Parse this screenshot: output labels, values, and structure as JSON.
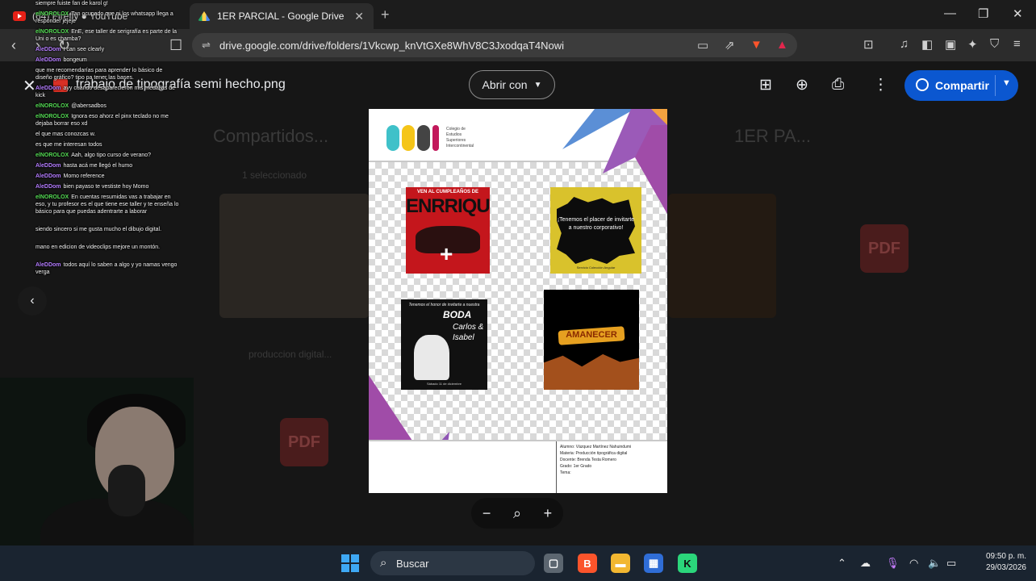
{
  "browser": {
    "tabs": [
      {
        "label": "(64) Firefly ● YouTube",
        "active": false
      },
      {
        "label": "1ER PARCIAL - Google Drive",
        "active": true
      }
    ],
    "url": "drive.google.com/drive/folders/1Vkcwp_knVtGXe8WhV8C3JxodqaT4Nowi",
    "brave_badge": "7"
  },
  "drive_bg": {
    "shared_heading": "Compartidos...",
    "folder_heading": "1ER PA...",
    "selection": "1 seleccionado",
    "file_bottom": "produccion digital..."
  },
  "preview": {
    "filename": "trabajo de tipografía semi hecho.png",
    "open_with_label": "Abrir con",
    "share_label": "Compartir"
  },
  "document": {
    "logo_letters": "CESI",
    "logo_text": "Colegio de Estudios Superiores Intercontinental",
    "card1": {
      "top": "VEN AL CUMPLEAÑOS DE",
      "big": "ENRRIQUE"
    },
    "card2": {
      "text": "¡Tenemos el placer de invitarte a nuestro corporativo!",
      "foot": "Servicio Colección Angular"
    },
    "card3": {
      "top": "Tenemos el honor de invitarte a nuestra",
      "boda": "BODA",
      "names": "Carlos & Isabel",
      "foot": "Sábado 11 de diciembre"
    },
    "card4": {
      "title": "AMANECER"
    },
    "footer_info": [
      "Alumno: Vázquez Martínez Nahuindumi",
      "Materia: Producción tipográfica digital",
      "Docente: Brenda Testa Romero",
      "Grado: 1er Grado",
      "Tema:"
    ]
  },
  "zoom": {
    "out": "−",
    "reset": "⌕",
    "in": "+"
  },
  "chat": [
    {
      "user": "",
      "text": "siempre fuiste fan de karol g!",
      "color": "#ffffff"
    },
    {
      "user": "elNOROLOX",
      "text": "Tan ocupado que ni los whatsapp llega a responder jejeje",
      "color": "#55dd55"
    },
    {
      "user": "elNOROLOX",
      "text": "EnE, ese taller de serigrafía es parte de la Uni o es chamba?",
      "color": "#55dd55"
    },
    {
      "user": "AleDDom",
      "text": "I can see clearly",
      "color": "#b47cff"
    },
    {
      "user": "AleDDom",
      "text": "bongeum",
      "color": "#b47cff"
    },
    {
      "user": "",
      "text": "que me recomendarías para aprender lo básico de diseño gráfico? tipo pa tener las bases.",
      "color": "#ffffff"
    },
    {
      "user": "AleDDom",
      "text": "ayy cuando desaparecieron mis medallas de kick",
      "color": "#b47cff"
    },
    {
      "user": "elNOROLOX",
      "text": "@abersadbos",
      "color": "#55dd55"
    },
    {
      "user": "elNOROLOX",
      "text": "Ignora eso ahorz el pinx teclado no me dejaba borrar eso xd",
      "color": "#55dd55"
    },
    {
      "user": "",
      "text": "el que mas conozcas w.",
      "color": "#ffffff"
    },
    {
      "user": "",
      "text": "es que me interesan todos",
      "color": "#ffffff"
    },
    {
      "user": "elNOROLOX",
      "text": "Aah, algo tipo curso de verano?",
      "color": "#55dd55"
    },
    {
      "user": "AleDDom",
      "text": "hasta acá me llegó el humo",
      "color": "#b47cff"
    },
    {
      "user": "AleDDom",
      "text": "Momo reference",
      "color": "#b47cff"
    },
    {
      "user": "AleDDom",
      "text": "bien payaso te vestiste hoy Momo",
      "color": "#b47cff"
    },
    {
      "user": "elNOROLOX",
      "text": "En cuentas resumidas vas a trabajar en eso, y tu profesor es el que tiene ese taller y te enseña lo básico para que puedas adentrarte a laborar",
      "color": "#55dd55"
    },
    {
      "user": "",
      "text": "siendo sincero si me gusta mucho el dibujo digital.",
      "color": "#ffffff"
    },
    {
      "user": "",
      "text": "mano en edicion de videoclips mejore un montón.",
      "color": "#ffffff"
    },
    {
      "user": "AleDDom",
      "text": "todos aquí lo saben a algo y yo namas vengo verga",
      "color": "#b47cff"
    }
  ],
  "taskbar": {
    "search_label": "Buscar",
    "time": "09:50 p. m.",
    "date": "29/03/2026"
  },
  "colors": {
    "share_blue": "#0b57d0",
    "card1_red": "#c4161c",
    "card2_yellow": "#d9c22c",
    "card4_orange": "#e6a020"
  }
}
